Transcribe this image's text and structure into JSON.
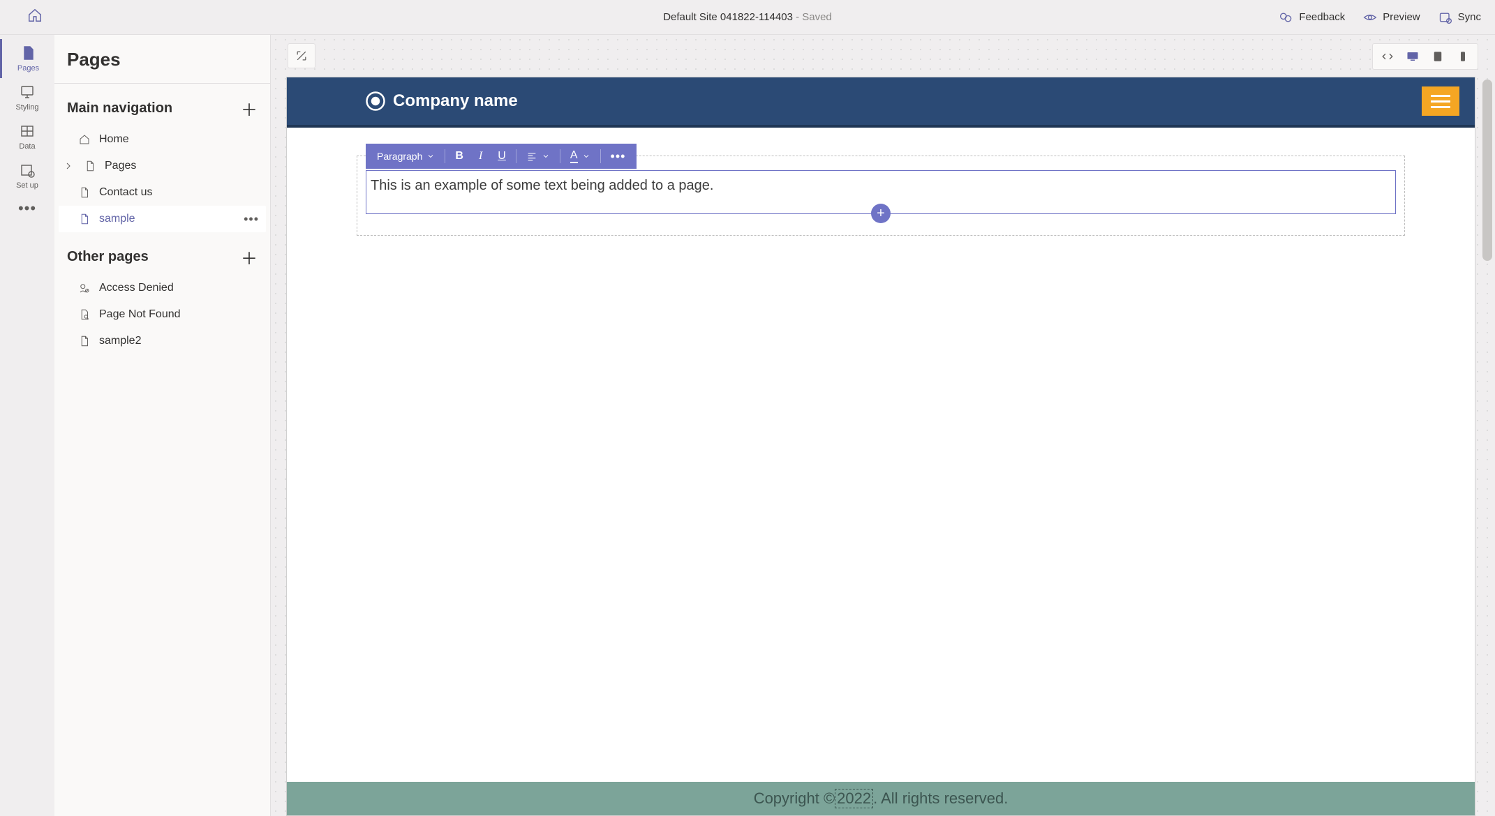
{
  "topbar": {
    "site_title": "Default Site 041822-114403",
    "status_suffix": " - Saved",
    "feedback_label": "Feedback",
    "preview_label": "Preview",
    "sync_label": "Sync"
  },
  "rail": {
    "items": [
      {
        "label": "Pages"
      },
      {
        "label": "Styling"
      },
      {
        "label": "Data"
      },
      {
        "label": "Set up"
      }
    ]
  },
  "panel": {
    "title": "Pages",
    "sections": {
      "main_nav": {
        "title": "Main navigation",
        "items": [
          {
            "label": "Home"
          },
          {
            "label": "Pages"
          },
          {
            "label": "Contact us"
          },
          {
            "label": "sample"
          }
        ]
      },
      "other": {
        "title": "Other pages",
        "items": [
          {
            "label": "Access Denied"
          },
          {
            "label": "Page Not Found"
          },
          {
            "label": "sample2"
          }
        ]
      }
    }
  },
  "rte": {
    "style_label": "Paragraph",
    "bold_glyph": "B",
    "italic_glyph": "I",
    "underline_glyph": "U",
    "color_glyph": "A",
    "more_glyph": "•••"
  },
  "preview": {
    "company_name": "Company name",
    "body_text": "This is an example of some text being added to a page.",
    "footer_prefix": "Copyright © ",
    "footer_year": "2022",
    "footer_suffix": ". All rights reserved."
  },
  "colors": {
    "accent": "#6264a7",
    "header_bg": "#2b4a75",
    "hamburger": "#f5a623",
    "rte_bg": "#6f73c6",
    "footer_bg": "#7ca499"
  }
}
